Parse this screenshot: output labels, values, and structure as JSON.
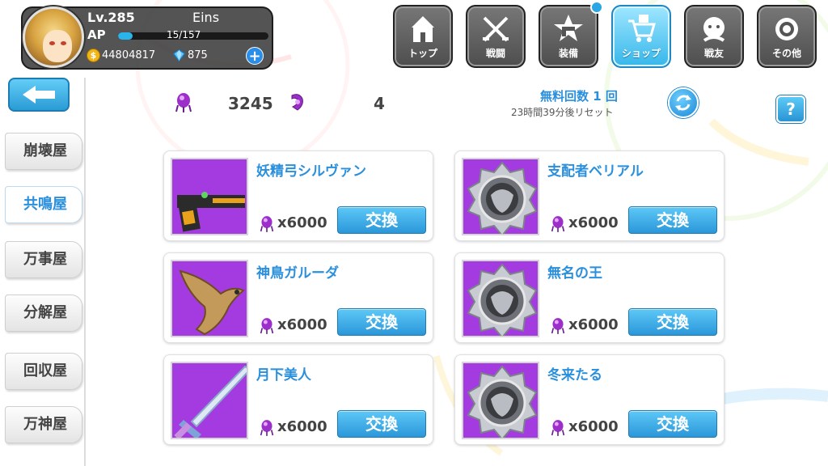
{
  "player": {
    "level": "Lv.285",
    "name": "Eins",
    "ap_label": "AP",
    "ap_text": "15/157",
    "ap_fraction": 0.0955,
    "gold": "44804817",
    "gems": "875",
    "gold_symbol": "$"
  },
  "nav": {
    "tabs": [
      {
        "label": "トップ",
        "icon": "castle-icon"
      },
      {
        "label": "戦闘",
        "icon": "crossed-swords-icon"
      },
      {
        "label": "装備",
        "icon": "gun-star-icon"
      },
      {
        "label": "ショップ",
        "icon": "shop-cart-icon"
      },
      {
        "label": "戦友",
        "icon": "friend-icon"
      },
      {
        "label": "その他",
        "icon": "settings-icon"
      }
    ],
    "active_index": 3
  },
  "sidebar": {
    "items": [
      {
        "label": "崩壊屋"
      },
      {
        "label": "共鳴屋"
      },
      {
        "label": "万事屋"
      },
      {
        "label": "分解屋"
      },
      {
        "label": "回収屋"
      },
      {
        "label": "万神屋"
      }
    ],
    "active_index": 1
  },
  "currency": {
    "crystal_count": "3245",
    "token_count": "4"
  },
  "free": {
    "count_text": "無料回数 1 回",
    "reset_text": "23時間39分後リセット"
  },
  "help_label": "?",
  "items": [
    {
      "name": "妖精弓シルヴァン",
      "cost": "x6000",
      "button": "交換",
      "thumb": "gun"
    },
    {
      "name": "支配者ベリアル",
      "cost": "x6000",
      "button": "交換",
      "thumb": "emblem"
    },
    {
      "name": "神鳥ガルーダ",
      "cost": "x6000",
      "button": "交換",
      "thumb": "bird"
    },
    {
      "name": "無名の王",
      "cost": "x6000",
      "button": "交換",
      "thumb": "emblem"
    },
    {
      "name": "月下美人",
      "cost": "x6000",
      "button": "交換",
      "thumb": "sword"
    },
    {
      "name": "冬来たる",
      "cost": "x6000",
      "button": "交換",
      "thumb": "emblem"
    }
  ],
  "colors": {
    "accent": "#2a8fdc",
    "button_blue": "#2b97d9",
    "thumb_purple": "#9b2ed3"
  }
}
